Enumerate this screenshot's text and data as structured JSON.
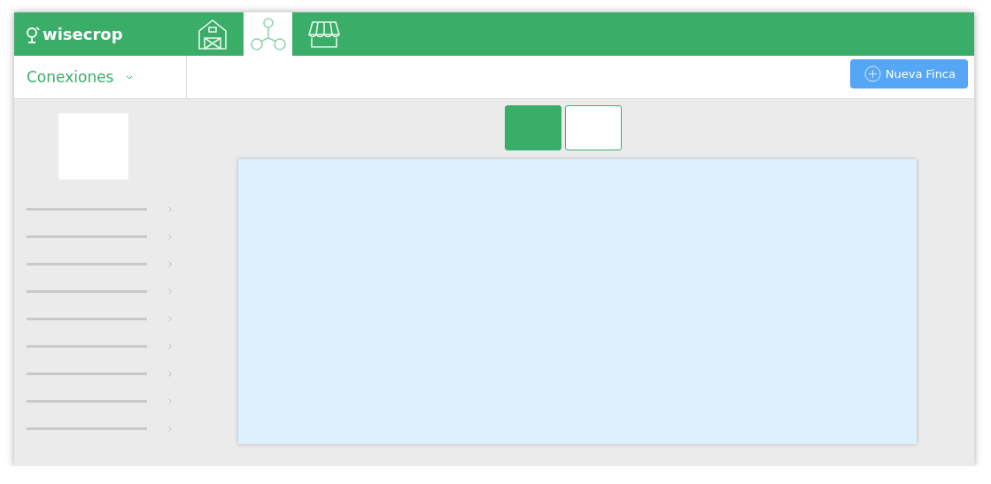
{
  "logo": {
    "text": "wisecrop"
  },
  "nav_tabs": [
    {
      "kind": "barn",
      "selected": false
    },
    {
      "kind": "network",
      "selected": true
    },
    {
      "kind": "market",
      "selected": false
    }
  ],
  "section": {
    "title": "Conexiones"
  },
  "new_button": {
    "label": "Nueva Finca"
  },
  "view_toggle": [
    {
      "selected": true
    },
    {
      "selected": false
    }
  ],
  "sidebar": {
    "items": [
      {
        "kind": "placeholder"
      },
      {
        "kind": "placeholder"
      },
      {
        "kind": "placeholder"
      },
      {
        "kind": "placeholder"
      },
      {
        "kind": "placeholder"
      },
      {
        "kind": "placeholder"
      },
      {
        "kind": "placeholder"
      },
      {
        "kind": "placeholder"
      },
      {
        "kind": "placeholder"
      }
    ]
  }
}
